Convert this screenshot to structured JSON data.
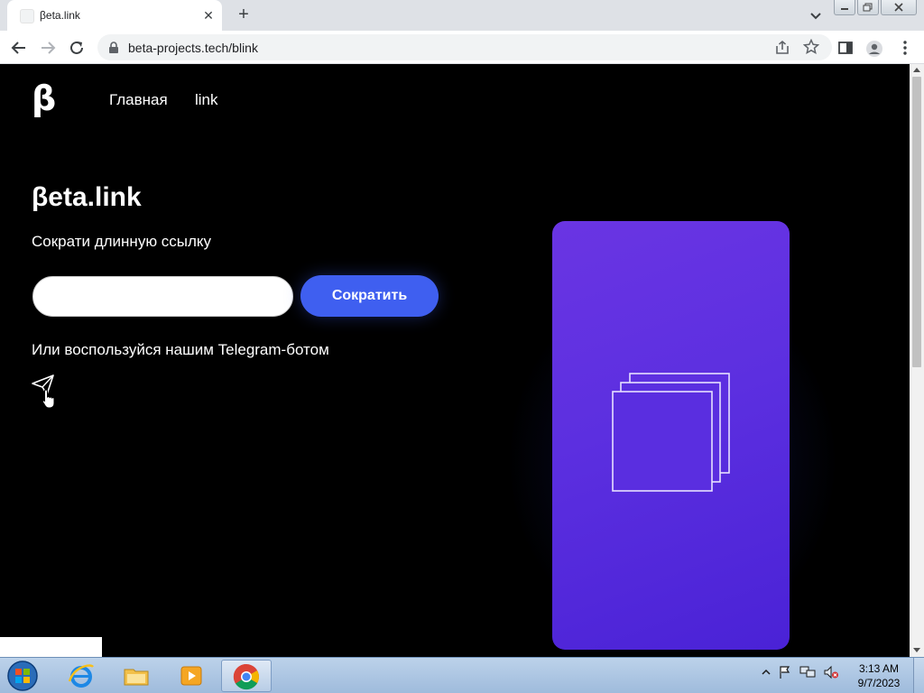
{
  "browser": {
    "tab_title": "βeta.link",
    "tab_close": "✕",
    "new_tab": "+",
    "url": "beta-projects.tech/blink"
  },
  "site": {
    "logo": "β",
    "nav": {
      "home": "Главная",
      "link": "link"
    },
    "hero": {
      "title": "βeta.link",
      "subtitle": "Сократи длинную ссылку",
      "input_value": "",
      "button_label": "Сократить",
      "telegram_text": "Или воспользуйся нашим Telegram-ботом"
    }
  },
  "taskbar": {
    "time": "3:13 AM",
    "date": "9/7/2023",
    "apps": [
      "internet-explorer-icon",
      "file-explorer-icon",
      "media-player-icon",
      "chrome-icon"
    ]
  },
  "colors": {
    "page_background": "#000000",
    "accent_button": "#3f5ff0",
    "card_gradient_start": "#6a35e3",
    "card_gradient_end": "#4a22d6"
  }
}
